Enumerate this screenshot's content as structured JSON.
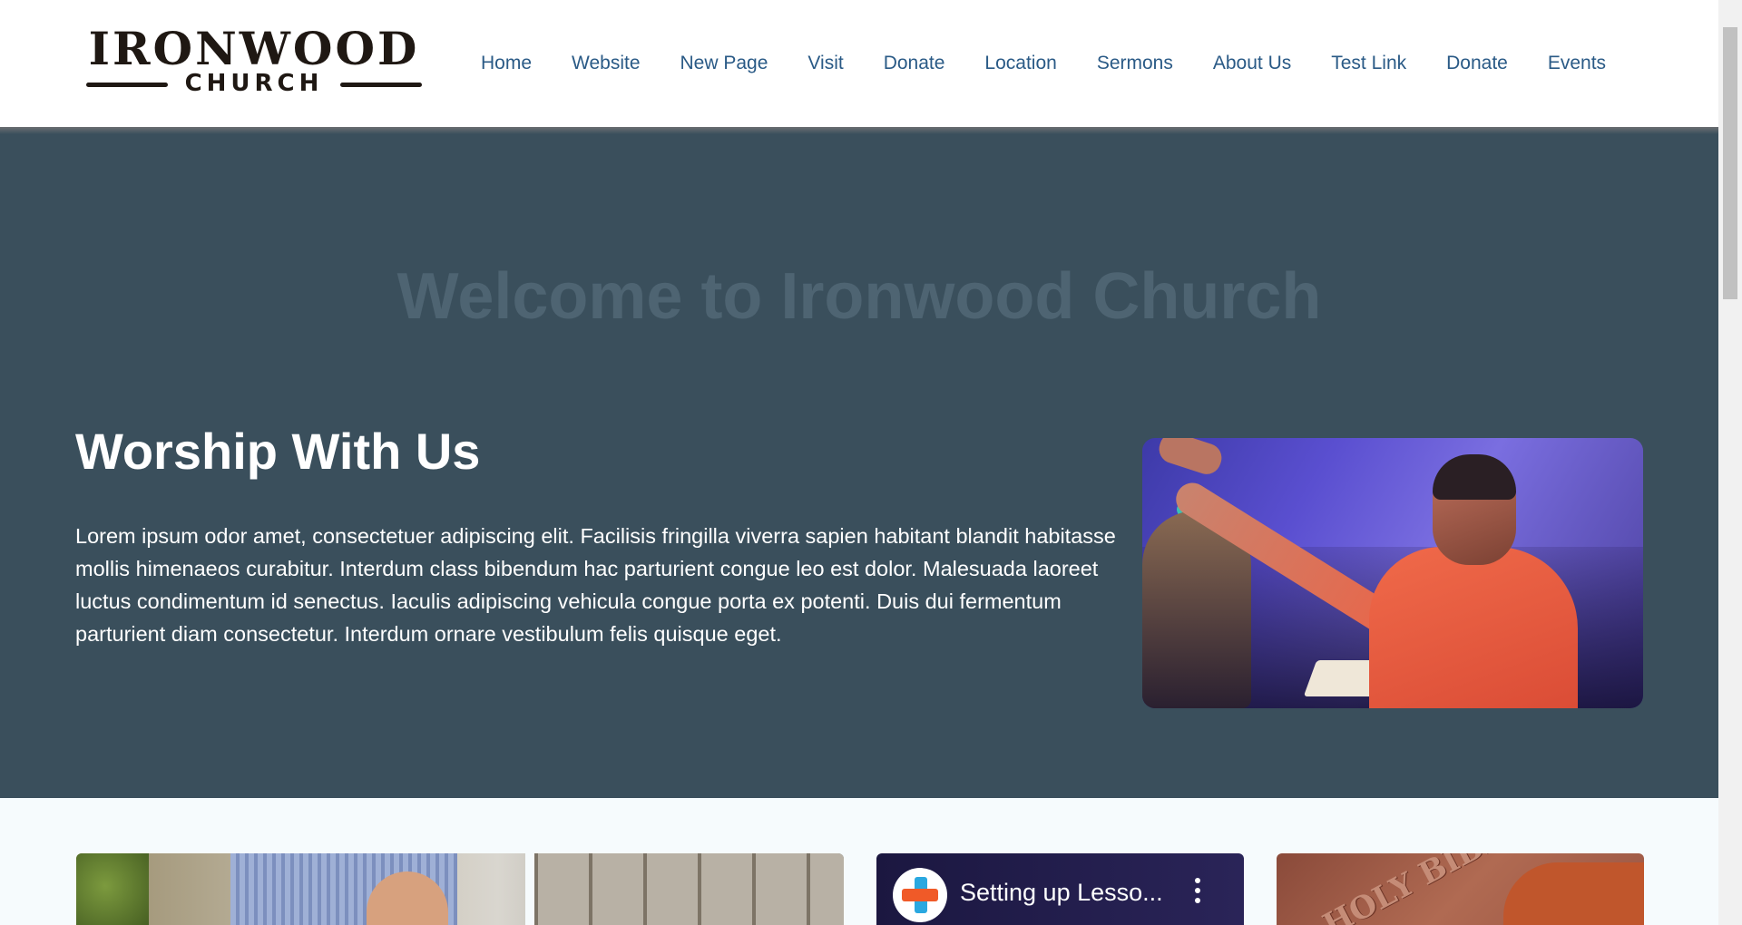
{
  "logo": {
    "line1": "IRONWOOD",
    "line2": "CHURCH"
  },
  "nav": {
    "items": [
      {
        "label": "Home"
      },
      {
        "label": "Website"
      },
      {
        "label": "New Page"
      },
      {
        "label": "Visit"
      },
      {
        "label": "Donate"
      },
      {
        "label": "Location"
      },
      {
        "label": "Sermons"
      },
      {
        "label": "About Us"
      },
      {
        "label": "Test Link"
      },
      {
        "label": "Donate"
      },
      {
        "label": "Events"
      }
    ]
  },
  "hero": {
    "welcome": "Welcome to Ironwood Church",
    "section_title": "Worship With Us",
    "body": "Lorem ipsum odor amet, consectetuer adipiscing elit. Facilisis fringilla viverra sapien habitant blandit habitasse mollis himenaeos curabitur. Interdum class bibendum hac parturient congue leo est dolor. Malesuada laoreet luctus condimentum id senectus. Iaculis adipiscing vehicula congue porta ex potenti. Duis dui fermentum parturient diam consectetur. Interdum ornare vestibulum felis quisque eget."
  },
  "lower": {
    "video_title": "Setting up Lesso...",
    "bible_text": "HOLY BIBLE"
  },
  "colors": {
    "nav_link": "#2a5a86",
    "hero_bg": "#3a4f5c",
    "lower_bg": "#f6fbfd"
  }
}
